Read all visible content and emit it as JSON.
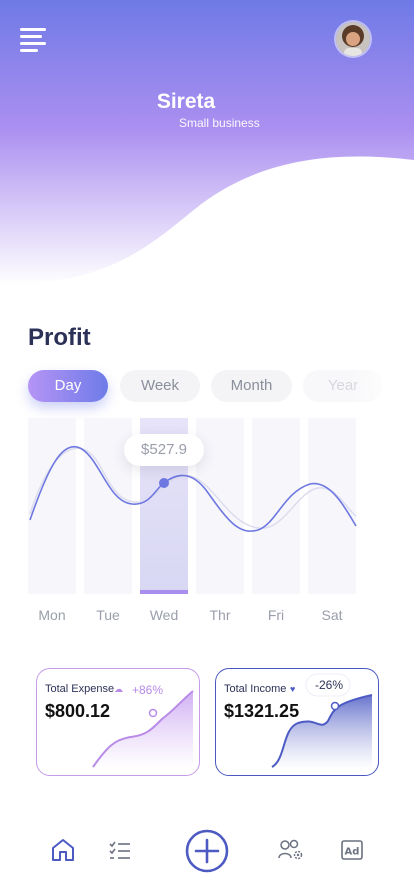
{
  "header": {
    "brand_name": "Sireta",
    "brand_subtitle": "Small business"
  },
  "profit": {
    "title": "Profit",
    "tabs": [
      {
        "label": "Day",
        "active": true
      },
      {
        "label": "Week",
        "active": false
      },
      {
        "label": "Month",
        "active": false
      },
      {
        "label": "Year",
        "active": false
      }
    ],
    "tooltip": "$527.9"
  },
  "chart_data": {
    "type": "line",
    "categories": [
      "Mon",
      "Tue",
      "Wed",
      "Thr",
      "Fri",
      "Sat"
    ],
    "selected_category": "Wed"
  },
  "cards": {
    "expense": {
      "label": "Total Expense",
      "trend_icon": "cloud-icon",
      "delta": "+86%",
      "value": "$800.12"
    },
    "income": {
      "label": "Total Income",
      "trend_icon": "heart-icon",
      "delta": "-26%",
      "value": "$1321.25"
    }
  },
  "nav": {
    "items": [
      "home-icon",
      "checklist-icon",
      "add-icon",
      "team-settings-icon",
      "ad-icon"
    ]
  },
  "colors": {
    "accent": "#6e7be8",
    "accent_light": "#b594f5",
    "title_text": "#2c3257",
    "expense_border": "#c89be8",
    "income_border": "#4a59c2"
  }
}
